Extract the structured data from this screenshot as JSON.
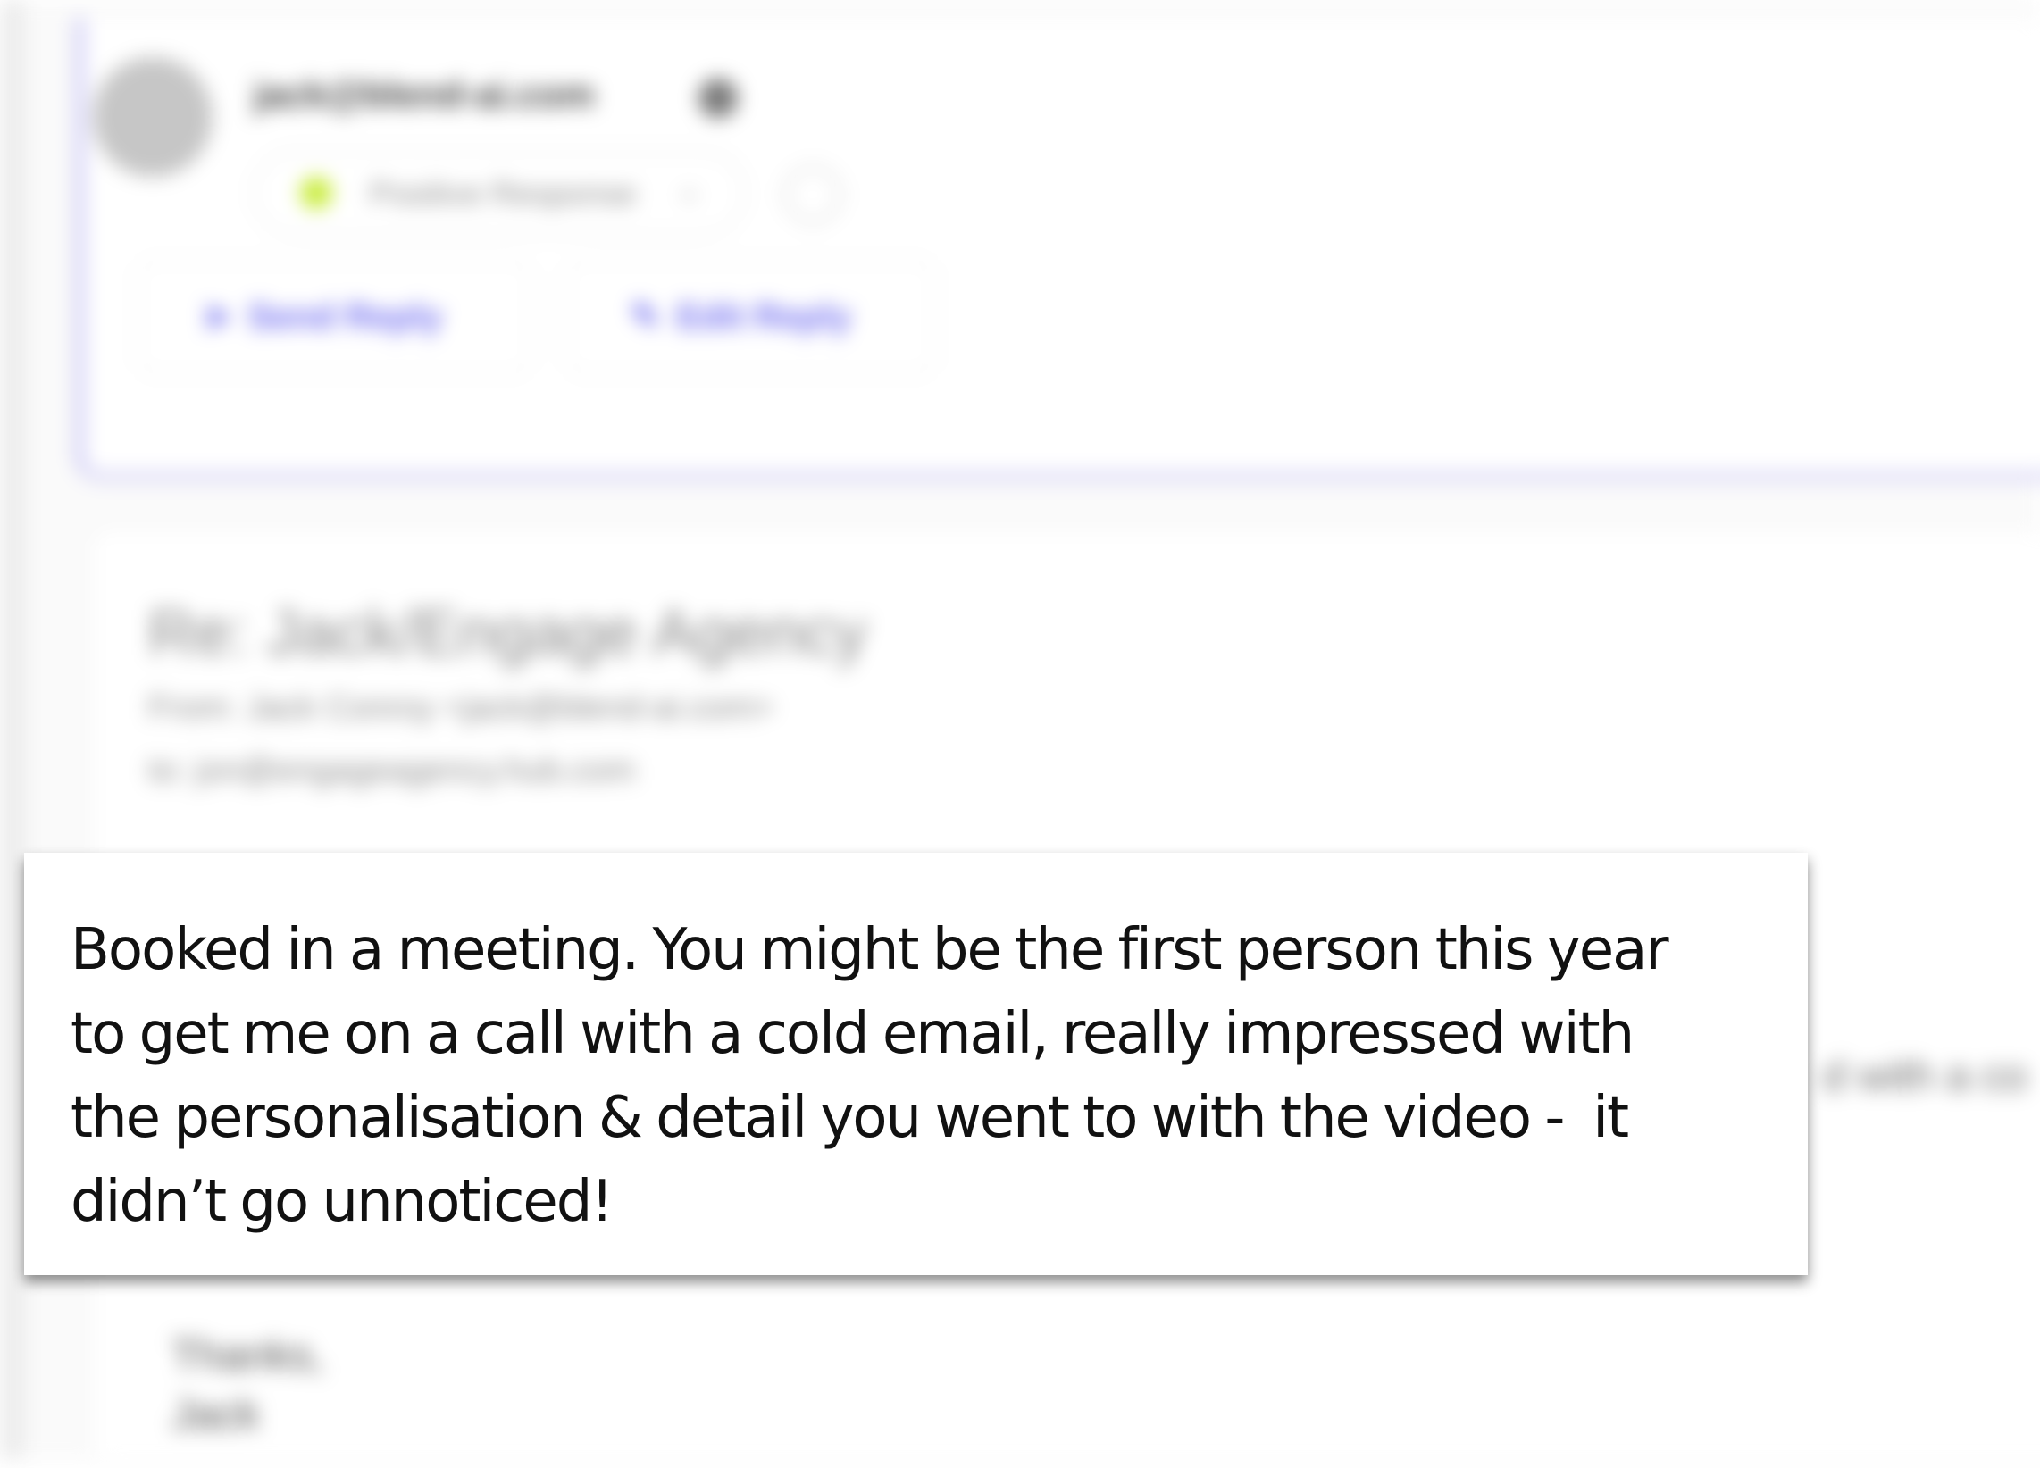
{
  "header": {
    "sender_email": "jack@blend-ai.com",
    "status_label": "Positive Response",
    "status_color": "#c8ec3a"
  },
  "actions": {
    "send_reply": "Send Reply",
    "edit_reply": "Edit Reply"
  },
  "email": {
    "subject": "Re: Jack/Engage Agency",
    "from": "From: Jack Conroy <jack@blend-ai.com>",
    "to": "to: jon@engageagency.hub.com",
    "body_peek": "d with a co",
    "signoff": "Thanks,",
    "signature": "Jack"
  },
  "testimonial": {
    "text": "Booked in a meeting. You might be the first person this year\nto get me on a call with a cold email, really impressed with\nthe personalisation & detail you went to with the video -  it\ndidn’t go unnoticed!"
  },
  "colors": {
    "accent": "#6f6cf0",
    "panel_border": "#b3aef2"
  }
}
